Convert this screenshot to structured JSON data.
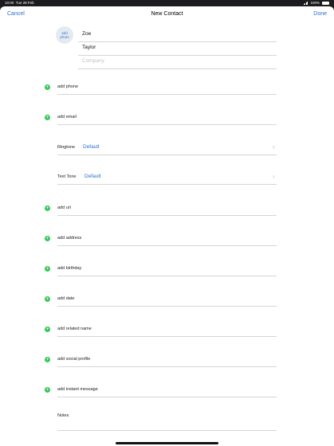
{
  "status": {
    "time": "10:00",
    "date": "Tue 28 Feb",
    "battery": "100%"
  },
  "nav": {
    "cancel": "Cancel",
    "title": "New Contact",
    "done": "Done"
  },
  "photo": {
    "label": "add\nphoto"
  },
  "name": {
    "first": "Zoe",
    "last": "Taylor",
    "company_placeholder": "Company"
  },
  "rows": {
    "phone": "add phone",
    "email": "add email",
    "ringtone_label": "Ringtone",
    "ringtone_value": "Default",
    "texttone_label": "Text Tone",
    "texttone_value": "Default",
    "url": "add url",
    "address": "add address",
    "birthday": "add birthday",
    "date": "add date",
    "related": "add related name",
    "social": "add social profile",
    "im": "add instant message",
    "notes": "Notes"
  },
  "icons": {
    "add": "+",
    "chevron": "›"
  },
  "colors": {
    "accent": "#2a6fd6",
    "add_green": "#35c759"
  }
}
